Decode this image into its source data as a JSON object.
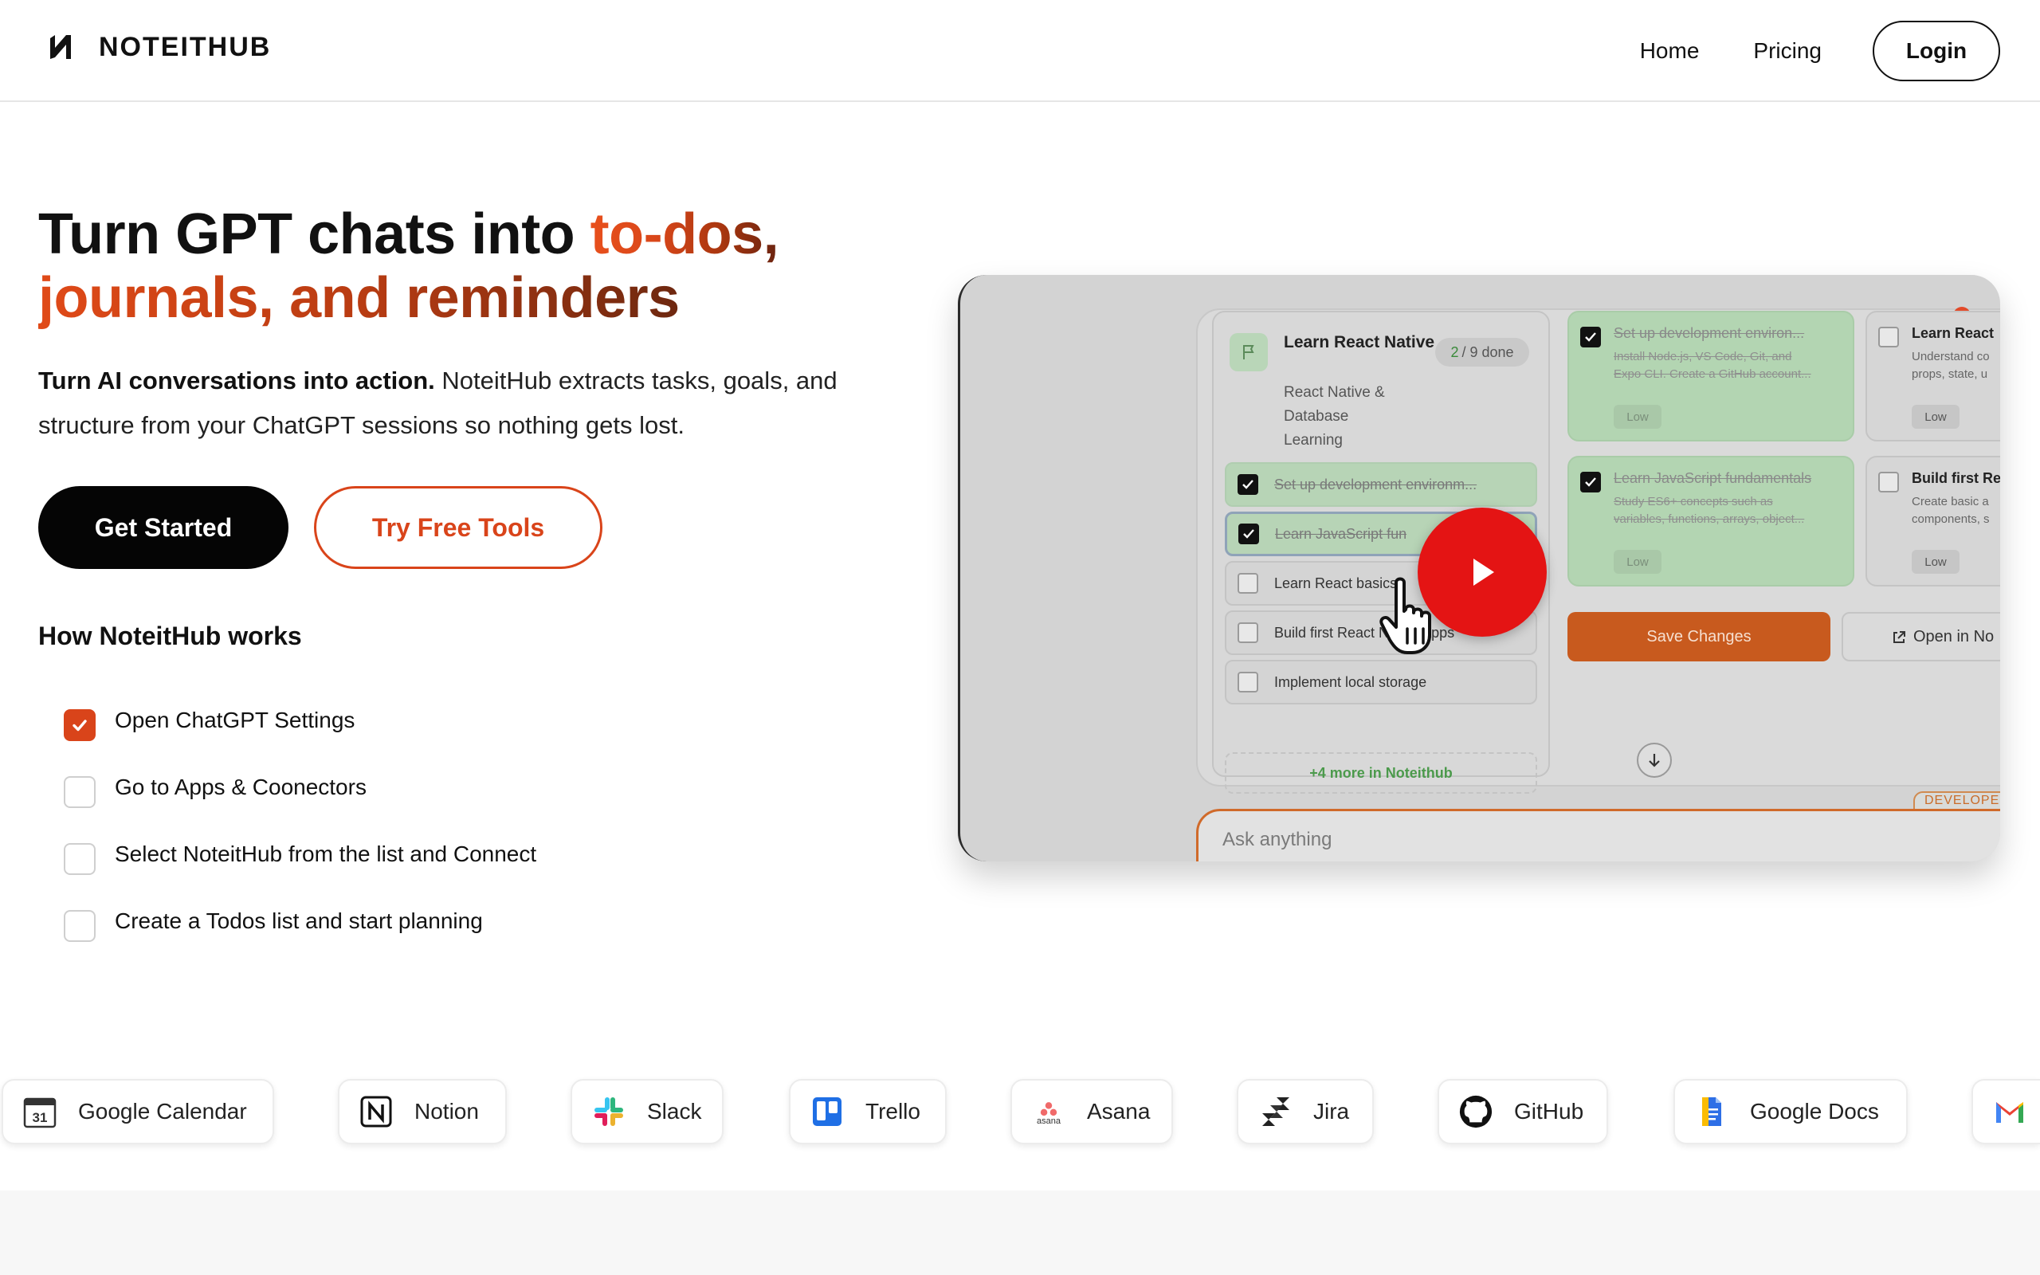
{
  "header": {
    "brand": "NOTEITHUB",
    "nav": {
      "home": "Home",
      "pricing": "Pricing",
      "login": "Login"
    }
  },
  "hero": {
    "title_plain": "Turn GPT chats into ",
    "title_highlight_1": "to-dos,",
    "title_highlight_2": "journals, and reminders",
    "subtitle_bold": "Turn AI conversations into action.",
    "subtitle_rest": " NoteitHub extracts tasks, goals, and structure from your ChatGPT sessions so nothing gets lost.",
    "cta_primary": "Get Started",
    "cta_secondary": "Try Free Tools"
  },
  "how_it_works": {
    "title": "How NoteitHub works",
    "steps": [
      {
        "label": "Open ChatGPT Settings",
        "checked": true
      },
      {
        "label": "Go to Apps & Coonectors",
        "checked": false
      },
      {
        "label": "Select NoteitHub from the list and Connect",
        "checked": false
      },
      {
        "label": "Create a Todos list and start planning",
        "checked": false
      }
    ]
  },
  "video": {
    "goal_title": "Learn React Native",
    "goal_desc": "React Native & Database Learning",
    "progress_done": "2",
    "progress_total": "/ 9  done",
    "rows": [
      {
        "label": "Set up development environm...",
        "done": true
      },
      {
        "label": "Learn JavaScript fun",
        "done": true
      },
      {
        "label": "Learn React basics",
        "done": false
      },
      {
        "label": "Build first React Native apps",
        "done": false
      },
      {
        "label": "Implement local storage",
        "done": false
      }
    ],
    "more": "+4 more in Noteithub",
    "tasks": [
      {
        "title": "Set up development environ...",
        "desc": "Install Node.js, VS Code, Git, and\nExpo CLI. Create a GitHub account...",
        "priority": "Low",
        "done": true
      },
      {
        "title": "Learn React",
        "desc": "Understand co\nprops, state, u",
        "priority": "Low",
        "done": false
      },
      {
        "title": "Learn JavaScript fundamentals",
        "desc": "Study ES6+ concepts such as\nvariables, functions, arrays, object...",
        "priority": "Low",
        "done": true
      },
      {
        "title": "Build first Re",
        "desc": "Create basic a\ncomponents, s",
        "priority": "Low",
        "done": false
      }
    ],
    "save_button": "Save Changes",
    "open_button": "Open in No",
    "developer_tag": "DEVELOPER",
    "input_placeholder": "Ask anything"
  },
  "integrations": [
    {
      "name": "Google Calendar",
      "icon": "calendar-icon"
    },
    {
      "name": "Notion",
      "icon": "notion-icon"
    },
    {
      "name": "Slack",
      "icon": "slack-icon"
    },
    {
      "name": "Trello",
      "icon": "trello-icon"
    },
    {
      "name": "Asana",
      "icon": "asana-icon"
    },
    {
      "name": "Jira",
      "icon": "jira-icon"
    },
    {
      "name": "GitHub",
      "icon": "github-icon"
    },
    {
      "name": "Google Docs",
      "icon": "google-docs-icon"
    },
    {
      "name": "",
      "icon": "gmail-icon"
    }
  ],
  "integration_icon_text": {
    "calendar_day": "31",
    "asana_word": "asana"
  },
  "colors": {
    "accent": "#d9441a",
    "dark": "#050505",
    "play_red": "#e41414"
  }
}
